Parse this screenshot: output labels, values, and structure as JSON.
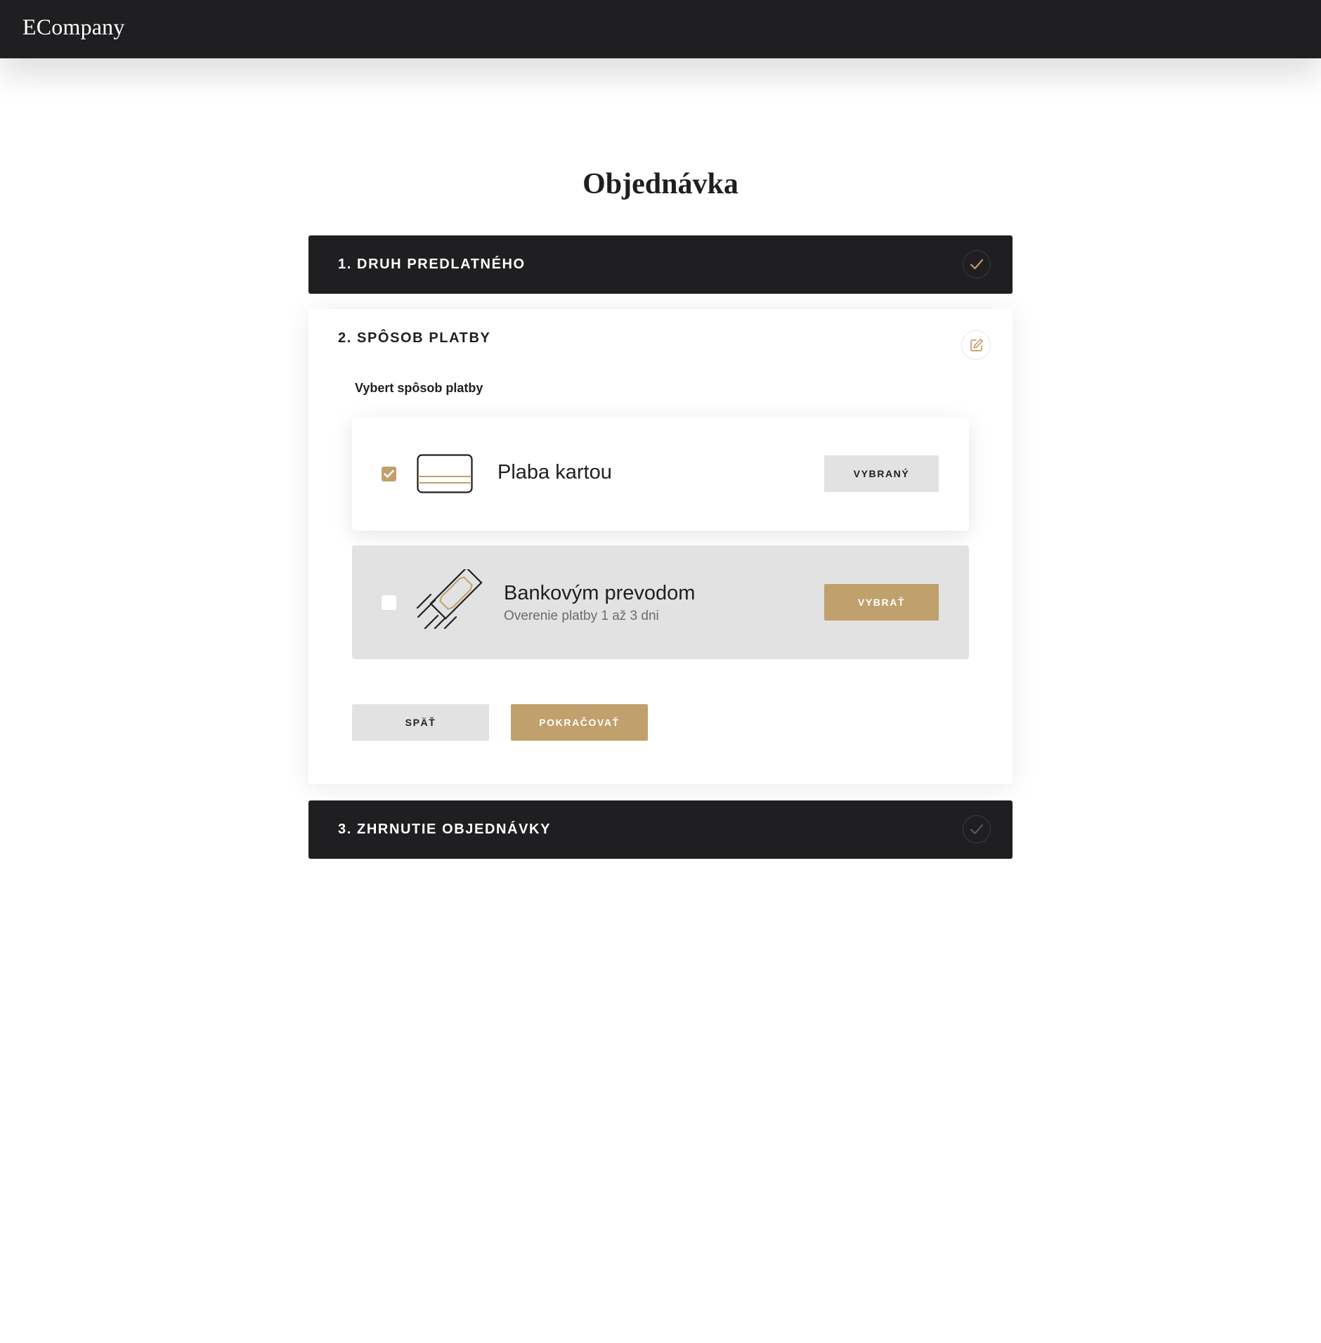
{
  "app": {
    "logo": "ECompany"
  },
  "page": {
    "title": "Objednávka"
  },
  "steps": [
    {
      "title": "1. DRUH PREDLATNÉHO",
      "status": "completed",
      "icon": "check-icon"
    },
    {
      "title": "2. SPÔSOB PLATBY",
      "status": "active",
      "icon": "edit-icon"
    },
    {
      "title": "3. ZHRNUTIE OBJEDNÁVKY",
      "status": "pending",
      "icon": "check-icon"
    }
  ],
  "payment": {
    "heading": "Vybert spôsob platby",
    "options": [
      {
        "label": "Plaba kartou",
        "sublabel": "",
        "checked": true,
        "button": "VYBRANÝ",
        "icon": "credit-card-icon"
      },
      {
        "label": "Bankovým prevodom",
        "sublabel": "Overenie platby 1 až 3 dni",
        "checked": false,
        "button": "VYBRAŤ",
        "icon": "bank-transfer-icon"
      }
    ]
  },
  "actions": {
    "back": "SPÄŤ",
    "continue": "POKRAČOVAŤ"
  },
  "colors": {
    "dark": "#1f1f21",
    "accent": "#c0a06c",
    "muted_bg": "#e2e2e2",
    "white": "#ffffff"
  }
}
